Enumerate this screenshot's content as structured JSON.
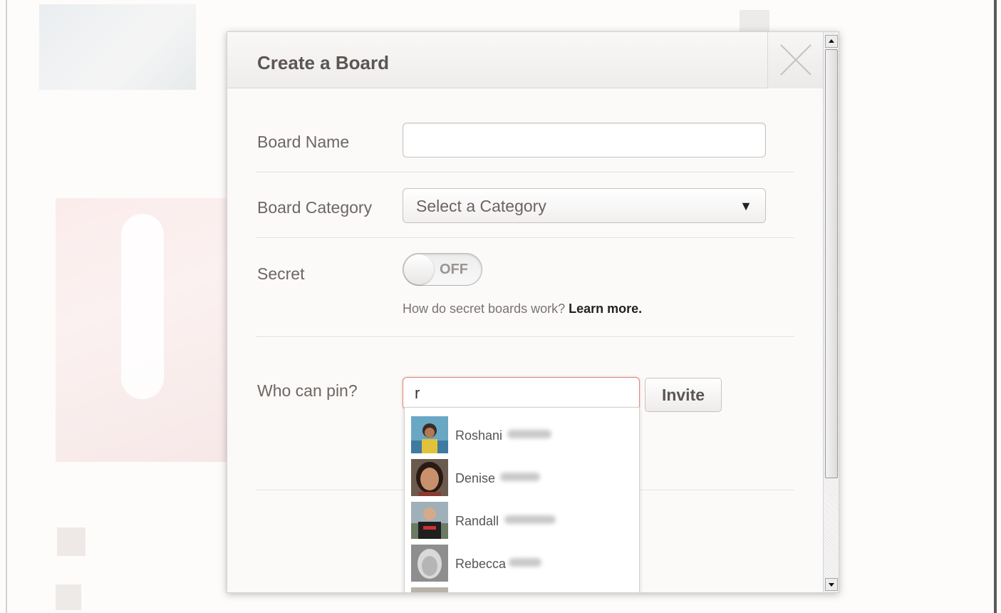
{
  "modal": {
    "title": "Create a Board",
    "fields": {
      "board_name": {
        "label": "Board Name",
        "value": "",
        "placeholder": ""
      },
      "board_category": {
        "label": "Board Category",
        "selected": "Select a Category",
        "caret": "▼"
      },
      "secret": {
        "label": "Secret",
        "state": "OFF",
        "help_text": "How do secret boards work?",
        "learn_more": "Learn more."
      },
      "who_can_pin": {
        "label": "Who can pin?",
        "value": "r",
        "invite_label": "Invite"
      }
    },
    "suggestions": [
      {
        "name": "Roshani"
      },
      {
        "name": "Denise"
      },
      {
        "name": "Randall"
      },
      {
        "name": "Rebecca"
      }
    ]
  },
  "colors": {
    "accent_focus": "#d98a7c",
    "title_text": "#5b5553"
  }
}
